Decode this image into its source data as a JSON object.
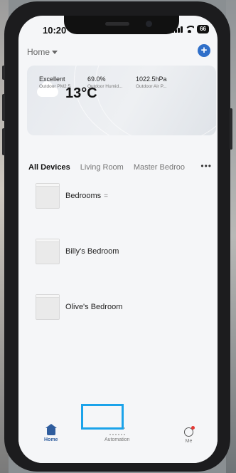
{
  "status_bar": {
    "time": "10:20",
    "battery": "66"
  },
  "header": {
    "home_label": "Home",
    "add_icon": "plus-icon"
  },
  "weather": {
    "icon": "cloud-icon",
    "temperature": "13°C",
    "stats": [
      {
        "value": "Excellent",
        "label": "Outdoor PM2.5"
      },
      {
        "value": "69.0%",
        "label": "Outdoor Humid..."
      },
      {
        "value": "1022.5hPa",
        "label": "Outdoor Air P..."
      }
    ]
  },
  "tabs": [
    "All Devices",
    "Living Room",
    "Master Bedroo"
  ],
  "rooms": [
    {
      "name": "Bedrooms",
      "extra": "="
    },
    {
      "name": "Billy's Bedroom"
    },
    {
      "name": "Olive's Bedroom"
    }
  ],
  "tabbar": [
    {
      "label": "Home",
      "icon": "home-icon"
    },
    {
      "label": "Automation",
      "icon": "automation-icon"
    },
    {
      "label": "Me",
      "icon": "profile-icon"
    }
  ],
  "colors": {
    "accent": "#2f6fc9",
    "highlight": "#1ba3ea",
    "badge": "#e53935"
  }
}
